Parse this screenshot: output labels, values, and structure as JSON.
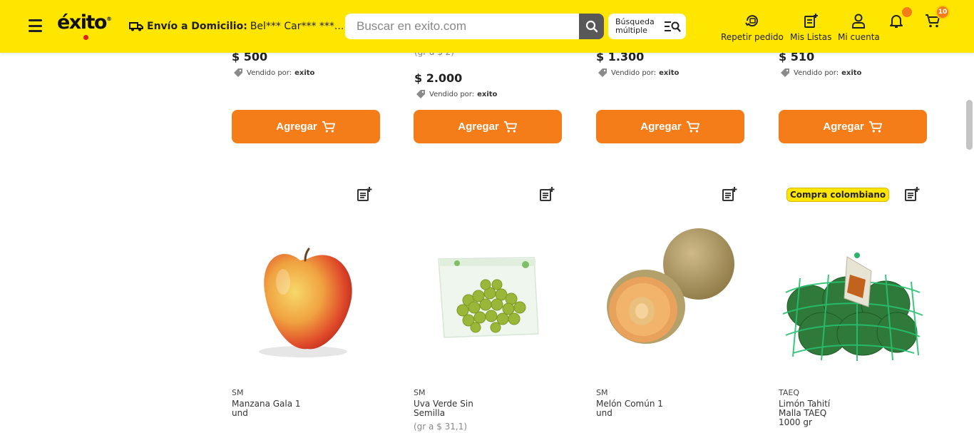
{
  "header": {
    "logo": "éxito",
    "delivery_label": "Envío a Domicilio:",
    "delivery_address": "Bel*** Car*** ***...",
    "search_placeholder": "Buscar en exito.com",
    "multi_search_label": "Búsqueda múltiple",
    "nav": {
      "repeat_order": "Repetir pedido",
      "my_lists": "Mis Listas",
      "my_account": "Mi cuenta"
    },
    "cart_count": "10",
    "accent_color": "#ffe600",
    "button_color": "#f47d1a"
  },
  "top_row": [
    {
      "price": "$ 500",
      "unit_price": "",
      "seller_label": "Vendido por:",
      "seller": "exito",
      "button": "Agregar"
    },
    {
      "price": "$ 2.000",
      "unit_price": "(gr a $ 2)",
      "seller_label": "Vendido por:",
      "seller": "exito",
      "button": "Agregar"
    },
    {
      "price": "$ 1.300",
      "unit_price": "",
      "seller_label": "Vendido por:",
      "seller": "exito",
      "button": "Agregar"
    },
    {
      "price": "$ 510",
      "unit_price": "",
      "seller_label": "Vendido por:",
      "seller": "exito",
      "button": "Agregar"
    }
  ],
  "products": [
    {
      "brand": "SM",
      "name": "Manzana Gala 1 und",
      "unit_price": "",
      "tag": "",
      "image": "red-yellow-apple"
    },
    {
      "brand": "SM",
      "name": "Uva Verde Sin Semilla",
      "unit_price": "(gr a $ 31,1)",
      "tag": "",
      "image": "green-grapes-bag"
    },
    {
      "brand": "SM",
      "name": "Melón Común 1 und",
      "unit_price": "",
      "tag": "",
      "image": "cantaloupe-melon"
    },
    {
      "brand": "TAEQ",
      "name": "Limón Tahití Malla TAEQ 1000 gr",
      "unit_price": "",
      "tag": "Compra colombiano",
      "image": "lime-mesh-bag"
    }
  ]
}
